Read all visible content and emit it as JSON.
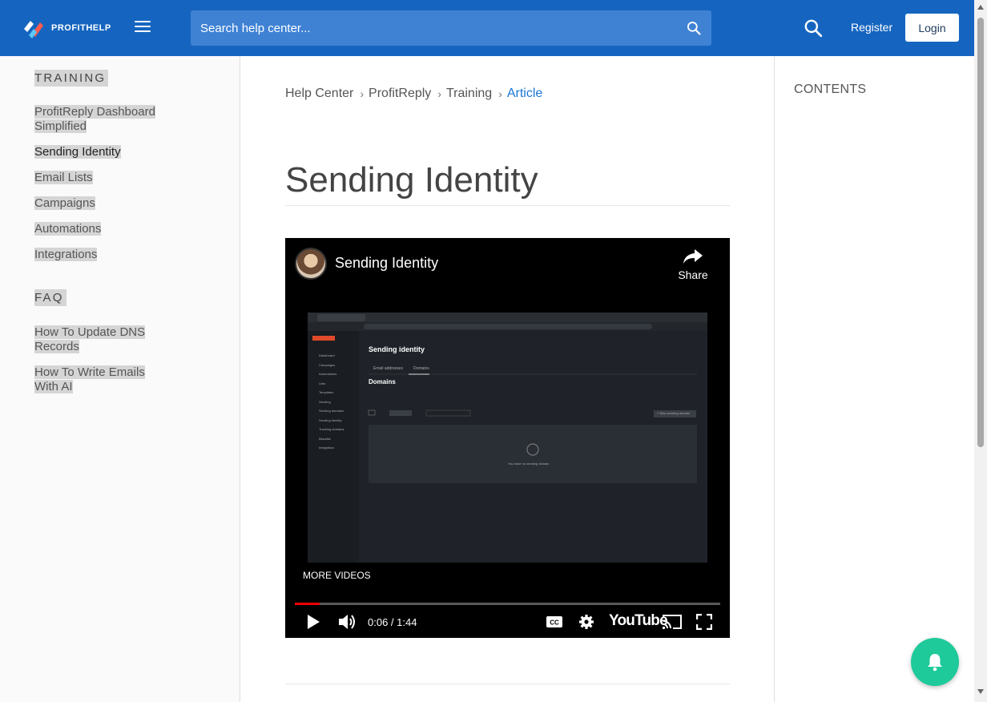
{
  "header": {
    "logo_text": "PROFITHELP",
    "search_placeholder": "Search help center...",
    "register_label": "Register",
    "login_label": "Login",
    "brand_color": "#1565c0"
  },
  "sidebar": {
    "sections": [
      {
        "title": "TRAINING",
        "items": [
          {
            "label": "ProfitReply Dashboard Simplified",
            "active": false
          },
          {
            "label": "Sending Identity",
            "active": true
          },
          {
            "label": "Email Lists",
            "active": false
          },
          {
            "label": "Campaigns",
            "active": false
          },
          {
            "label": "Automations",
            "active": false
          },
          {
            "label": "Integrations",
            "active": false
          }
        ]
      },
      {
        "title": "FAQ",
        "items": [
          {
            "label": "How To Update DNS Records",
            "active": false
          },
          {
            "label": "How To Write Emails With AI",
            "active": false
          }
        ]
      }
    ]
  },
  "breadcrumb": [
    "Help Center",
    "ProfitReply",
    "Training",
    "Article"
  ],
  "article": {
    "title": "Sending Identity"
  },
  "video": {
    "title": "Sending Identity",
    "share_label": "Share",
    "more_videos_label": "MORE VIDEOS",
    "time": "0:06 / 1:44",
    "progress": 0.058,
    "youtube_label": "YouTube",
    "thumbnail": {
      "page_title": "Sending identity",
      "tab_email": "Email addresses",
      "tab_domains": "Domains",
      "section": "Domains",
      "empty_text": "You have no sending domain",
      "new_button": "+ New sending domain",
      "menu": [
        "Dashboard",
        "Campaigns",
        "Automations",
        "Lists",
        "Templates",
        "Sending",
        "Sending domains",
        "Sending identity",
        "Tracking domains",
        "Blacklist",
        "Integration"
      ]
    }
  },
  "toc": {
    "title": "CONTENTS"
  },
  "fab": {
    "icon": "bell-icon",
    "color": "#1ec99a"
  }
}
